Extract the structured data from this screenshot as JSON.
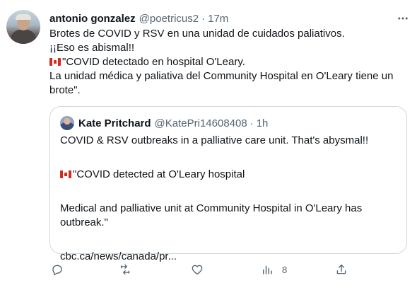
{
  "tweet": {
    "author_name": "antonio gonzalez",
    "author_handle": "@poetricus2",
    "separator": "·",
    "time": "17m",
    "lines": [
      "Brotes de COVID y RSV en una unidad de cuidados paliativos.",
      "¡¡Eso es abismal!!",
      "\"COVID detectado en hospital O'Leary.",
      "La unidad médica y paliativa del Community Hospital en O'Leary tiene un",
      "brote\"."
    ]
  },
  "quote": {
    "author_name": "Kate Pritchard",
    "author_handle": "@KatePri14608408",
    "separator": "·",
    "time": "1h",
    "lines": [
      "COVID & RSV outbreaks in a palliative care unit. That's abysmal!!",
      "\"COVID detected at O'Leary hospital",
      "Medical and palliative unit at Community Hospital in O'Leary has",
      "outbreak.\"",
      "cbc.ca/news/canada/pr..."
    ]
  },
  "actions": {
    "views_count": "8"
  },
  "icons": {
    "more": "more-dots-icon",
    "reply": "reply-icon",
    "retweet": "retweet-icon",
    "like": "heart-icon",
    "analytics": "analytics-icon",
    "share": "share-icon",
    "flag": "canada-flag-icon"
  },
  "colors": {
    "text": "#0f1419",
    "secondary": "#536471",
    "border": "#cfd9de"
  }
}
